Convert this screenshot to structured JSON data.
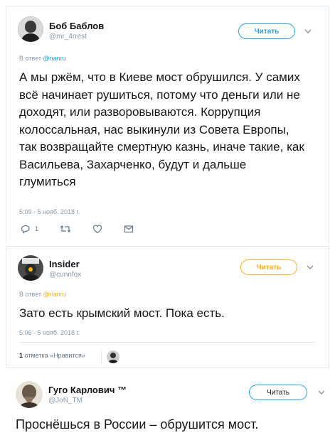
{
  "tweet1": {
    "name": "Боб Баблов",
    "handle": "@mr_4rrest",
    "follow_label": "Читать",
    "reply_prefix": "В ответ",
    "reply_to": "@rianru",
    "text": "А мы ржём, что в Киеве мост обрушился. У самих всё начинает рушиться, потому что деньги или не доходят, или разворовываются. Коррупция колоссальная, нас выкинули из Совета Европы, так возвращайте смертную казнь, иначе такие, как Васильева, Захарченко, будут и дальше глумиться",
    "timestamp": "5:09 - 5 нояб. 2018 г.",
    "reply_count": "1"
  },
  "tweet2": {
    "name": "Insider",
    "handle": "@cunnfox",
    "follow_label": "Читать",
    "reply_prefix": "В ответ",
    "reply_to": "@rianru",
    "text": "Зато есть крымский мост. Пока есть.",
    "timestamp": "5:06 - 5 нояб. 2018 г.",
    "likes_count": "1",
    "likes_label": "отметка «Нравится»"
  },
  "tweet3": {
    "name": "Гуго Карлович ™",
    "handle": "@JoN_TM",
    "follow_label": "Читать",
    "text": "Проснёшься в России – обрушится мост."
  },
  "colors": {
    "accent": "#1da1f2",
    "highlight": "#ffad1f",
    "muted": "#8899a6"
  },
  "icons": [
    "reply-icon",
    "retweet-icon",
    "like-icon",
    "direct-message-icon",
    "chevron-down-icon"
  ]
}
